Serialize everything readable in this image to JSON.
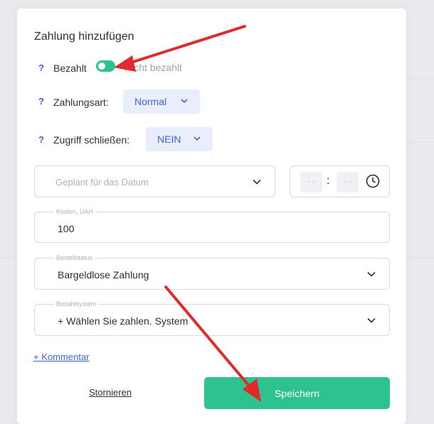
{
  "modal": {
    "title": "Zahlung hinzufügen",
    "help_mark": "?",
    "paid": {
      "label": "Bezahlt",
      "toggle_state": "on",
      "off_label": "Nicht bezahlt"
    },
    "payment_type": {
      "label": "Zahlungsart:",
      "value": "Normal"
    },
    "close_access": {
      "label": "Zugriff schließen:",
      "value": "NEIN"
    },
    "planned_date": {
      "placeholder": "Geplant für das Datum"
    },
    "time": {
      "hours_placeholder": "- -",
      "minutes_placeholder": "- -",
      "separator": ":"
    },
    "cost": {
      "legend": "Kosten, UAH",
      "value": "100"
    },
    "order_status": {
      "legend": "Bestellstatus",
      "value": "Bargeldlose Zahlung"
    },
    "payment_system": {
      "legend": "Bezahlsystem",
      "value": "+ Wählen Sie zahlen. System"
    },
    "add_comment": "+ Kommentar",
    "cancel_label": "Stornieren",
    "save_label": "Speichern"
  },
  "colors": {
    "accent_green": "#2ec28e",
    "accent_blue": "#3d63d8",
    "annotation_red": "#e02b2b"
  },
  "icons": [
    "chevron-down-icon",
    "clock-icon",
    "red-arrow-annotation"
  ]
}
